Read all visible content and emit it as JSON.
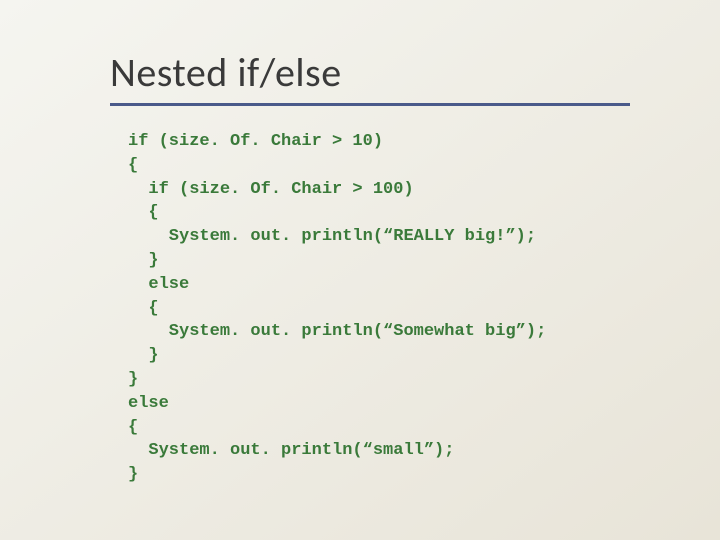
{
  "title": "Nested if/else",
  "code": {
    "l1": "if (size. Of. Chair > 10)",
    "l2": "{",
    "l3": "  if (size. Of. Chair > 100)",
    "l4": "  {",
    "l5": "    System. out. println(“REALLY big!”);",
    "l6": "  }",
    "l7": "  else",
    "l8": "  {",
    "l9": "    System. out. println(“Somewhat big”);",
    "l10": "  }",
    "l11": "}",
    "l12": "else",
    "l13": "{",
    "l14": "  System. out. println(“small”);",
    "l15": "}"
  }
}
